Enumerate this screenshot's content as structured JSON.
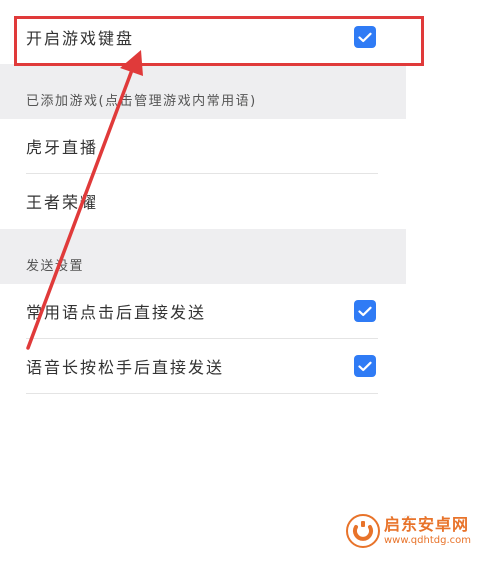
{
  "toggle_game_keyboard": {
    "label": "开启游戏键盘",
    "checked": true
  },
  "added_games": {
    "header": "已添加游戏(点击管理游戏内常用语)",
    "items": [
      {
        "label": "虎牙直播"
      },
      {
        "label": "王者荣耀"
      }
    ]
  },
  "send_settings": {
    "header": "发送设置",
    "items": [
      {
        "label": "常用语点击后直接发送",
        "checked": true
      },
      {
        "label": "语音长按松手后直接发送",
        "checked": true
      }
    ]
  },
  "watermark": {
    "name": "启东安卓网",
    "url": "www.qdhtdg.com"
  },
  "colors": {
    "accent": "#2f7bf5",
    "annotation": "#e03a3a",
    "section_bg": "#eeeef0",
    "watermark": "#e8732a"
  },
  "icons": {
    "checkbox": "check-icon"
  }
}
